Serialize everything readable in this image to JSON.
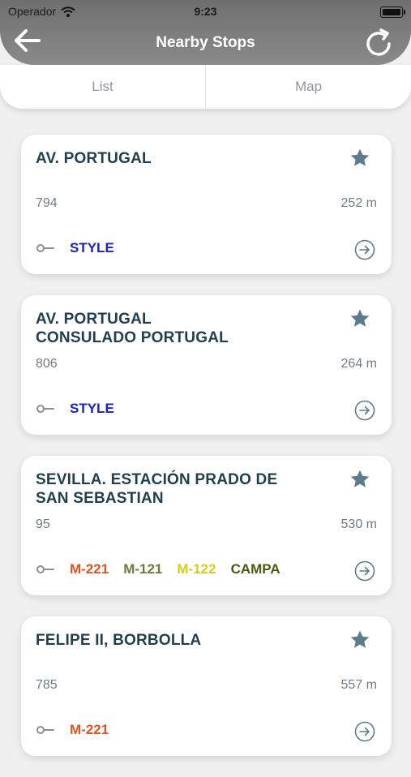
{
  "status_bar": {
    "carrier": "Operador",
    "time": "9:23"
  },
  "header": {
    "title": "Nearby Stops"
  },
  "tabs": [
    {
      "label": "List"
    },
    {
      "label": "Map"
    }
  ],
  "stops": [
    {
      "name": "AV. PORTUGAL",
      "id": "794",
      "distance": "252 m",
      "lines": [
        {
          "label": "STYLE",
          "color": "#1a22c8"
        }
      ]
    },
    {
      "name": "AV. PORTUGAL\nCONSULADO PORTUGAL",
      "id": "806",
      "distance": "264 m",
      "lines": [
        {
          "label": "STYLE",
          "color": "#1a22c8"
        }
      ]
    },
    {
      "name": "SEVILLA. ESTACIÓN PRADO DE\nSAN SEBASTIAN",
      "id": "95",
      "distance": "530 m",
      "lines": [
        {
          "label": "M-221",
          "color": "#e0541f"
        },
        {
          "label": "M-121",
          "color": "#6f7a3a"
        },
        {
          "label": "M-122",
          "color": "#d8cc1a"
        },
        {
          "label": "CAMPA",
          "color": "#4b5a10"
        }
      ]
    },
    {
      "name": "FELIPE II, BORBOLLA",
      "id": "785",
      "distance": "557 m",
      "lines": [
        {
          "label": "M-221",
          "color": "#e0541f"
        }
      ]
    }
  ],
  "icons": {
    "back": "back-arrow-icon",
    "refresh": "refresh-icon",
    "wifi": "wifi-icon",
    "battery": "battery-icon",
    "star": "star-icon",
    "line": "bus-line-icon",
    "go": "arrow-circle-icon"
  },
  "colors": {
    "header": "#7a7a7a",
    "title_text": "#1f3f4f",
    "star": "#5c7b8d",
    "secondary_text": "#6d7d87"
  }
}
